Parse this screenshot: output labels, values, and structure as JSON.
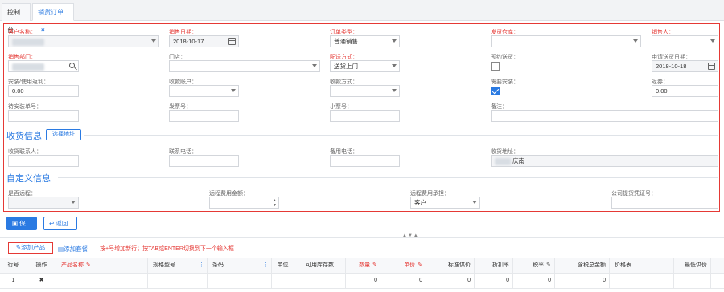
{
  "tabs": [
    {
      "label": "控制台",
      "active": false
    },
    {
      "label": "销货订单",
      "active": true,
      "close": "×"
    }
  ],
  "form": {
    "customer_label": "客户名称：",
    "sale_date_label": "销售日期：",
    "sale_date_value": "2018-10-17",
    "order_type_label": "订单类型：",
    "order_type_value": "普通销售",
    "warehouse_label": "发货仓库：",
    "seller_label": "销售人：",
    "dept_label": "销售部门：",
    "store_label": "门店：",
    "delivery_label": "配送方式：",
    "delivery_value": "送货上门",
    "reserve_label": "预约送货：",
    "apply_date_label": "申请送货日期：",
    "apply_date_value": "2018-10-18",
    "install_fee_label": "安装/使用返利：",
    "install_fee_value": "0.00",
    "account_label": "收款账户：",
    "collect_label": "收款方式：",
    "need_install_label": "需要安装：",
    "need_install_checked": true,
    "discount_label": "返券：",
    "discount_value": "0.00",
    "install_no_label": "待安装单号：",
    "invoice_label": "发票号：",
    "ticket_label": "小票号：",
    "remark_label": "备注："
  },
  "receive": {
    "title": "收货信息",
    "address_button": "选择地址",
    "contact_label": "收货联系人：",
    "phone_label": "联系电话：",
    "alt_phone_label": "备用电话：",
    "address_label": "收货地址：",
    "address_value": "庆南"
  },
  "custom": {
    "title": "自定义信息",
    "remote_label": "是否远程：",
    "remote_fee_label": "远程费用金额：",
    "remote_payer_label": "远程费用承担：",
    "remote_payer_value": "客户",
    "company_cert_label": "公司提货凭证号："
  },
  "actions": {
    "save": "保存",
    "back": "返回",
    "grip": "▲▼▲",
    "add_product": "添加产品",
    "add_package": "添加套餐",
    "hint": "按+号增加新行；按TAB或ENTER切换到下一个输入框"
  },
  "table": {
    "headers": [
      "行号",
      "操作",
      "产品名称",
      "规格型号",
      "条码",
      "单位",
      "可用库存数",
      "数量",
      "单价",
      "标准供价",
      "折扣率",
      "税率",
      "含税总金额",
      "价格表",
      "最低供价"
    ],
    "row": {
      "no": "1",
      "op": "✖",
      "qty": "0",
      "price": "0",
      "std": "0",
      "disc": "0",
      "tax": "0",
      "total": "0"
    }
  }
}
